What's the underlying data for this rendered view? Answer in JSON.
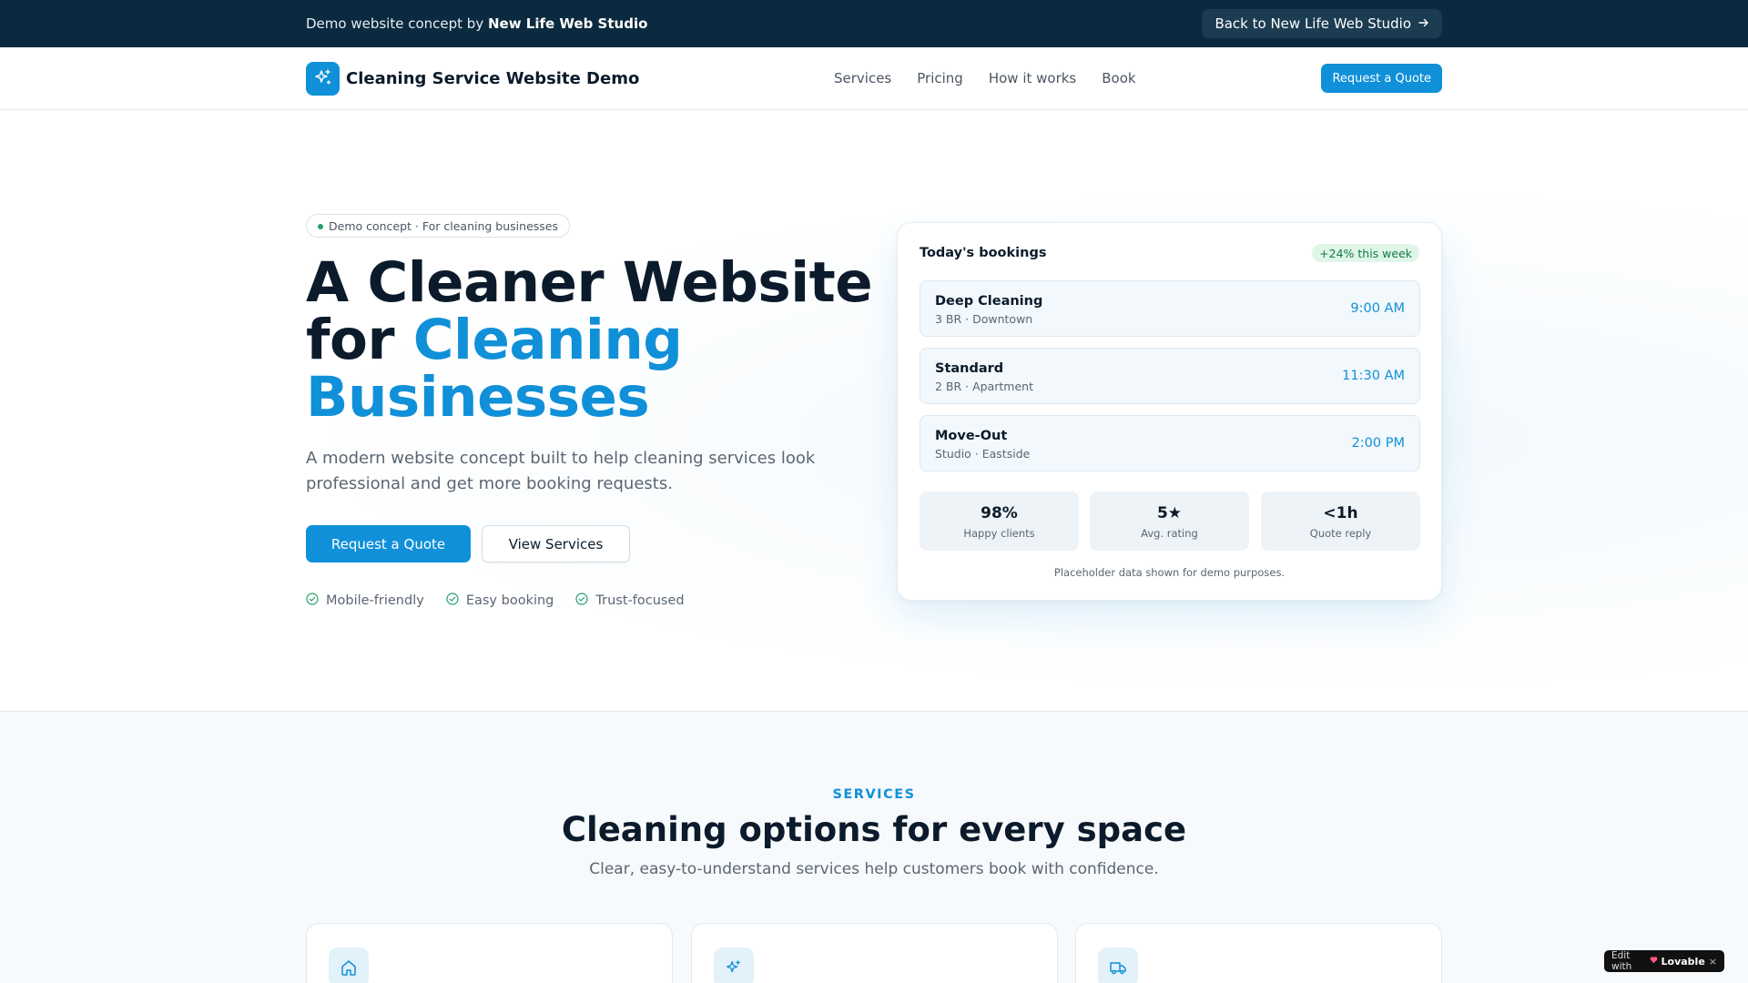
{
  "banner": {
    "text_prefix": "Demo website concept by",
    "studio_name": "New Life Web Studio",
    "back_button": "Back to New Life Web Studio"
  },
  "nav": {
    "brand": "Cleaning Service Website Demo",
    "links": [
      "Services",
      "Pricing",
      "How it works",
      "Book"
    ],
    "cta": "Request a Quote"
  },
  "hero": {
    "pill": "Demo concept · For cleaning businesses",
    "headline_line1": "A Cleaner Website",
    "headline_for": "for",
    "headline_accent1": "Cleaning",
    "headline_accent2": "Businesses",
    "lede": "A modern website concept built to help cleaning services look professional and get more booking requests.",
    "primary_button": "Request a Quote",
    "secondary_button": "View Services",
    "features": [
      "Mobile-friendly",
      "Easy booking",
      "Trust-focused"
    ]
  },
  "bookings_card": {
    "title": "Today's bookings",
    "badge": "+24% this week",
    "bookings": [
      {
        "name": "Deep Cleaning",
        "details": "3 BR · Downtown",
        "time": "9:00 AM"
      },
      {
        "name": "Standard",
        "details": "2 BR · Apartment",
        "time": "11:30 AM"
      },
      {
        "name": "Move-Out",
        "details": "Studio · Eastside",
        "time": "2:00 PM"
      }
    ],
    "stats": [
      {
        "value": "98%",
        "label": "Happy clients"
      },
      {
        "value": "5★",
        "label": "Avg. rating"
      },
      {
        "value": "<1h",
        "label": "Quote reply"
      }
    ],
    "note": "Placeholder data shown for demo purposes."
  },
  "services": {
    "eyebrow": "SERVICES",
    "title": "Cleaning options for every space",
    "subtitle": "Clear, easy-to-understand services help customers book with confidence.",
    "card_icons": [
      "home-icon",
      "sparkles-icon",
      "truck-icon"
    ]
  },
  "lovable_badge": {
    "prefix": "Edit with",
    "name": "Lovable",
    "close": "×"
  },
  "colors": {
    "banner_bg": "#0b2a3f",
    "accent": "#1090d8",
    "success": "#22a06b",
    "text_dark": "#0b1b2b",
    "text_muted": "#5b6673"
  }
}
